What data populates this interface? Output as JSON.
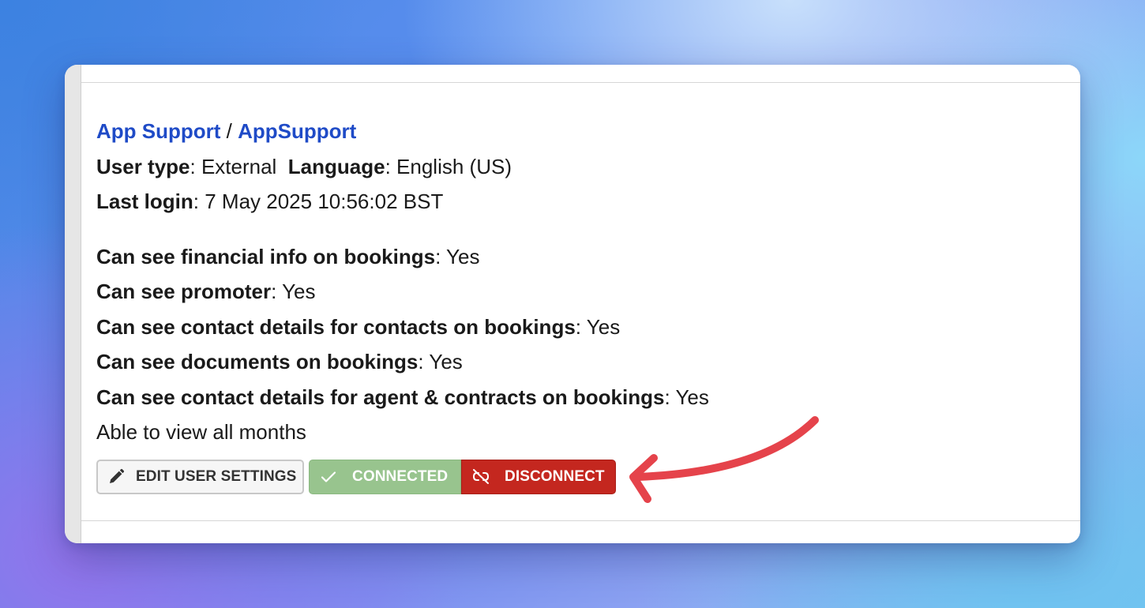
{
  "user": {
    "group_link": "App Support",
    "separator": "/",
    "name_link": "AppSupport",
    "user_type_label": "User type",
    "user_type_value": "External",
    "language_label": "Language",
    "language_value": "English (US)",
    "last_login_label": "Last login",
    "last_login_value": "7 May 2025 10:56:02 BST"
  },
  "permissions": [
    {
      "label": "Can see financial info on bookings",
      "value": "Yes"
    },
    {
      "label": "Can see promoter",
      "value": "Yes"
    },
    {
      "label": "Can see contact details for contacts on bookings",
      "value": "Yes"
    },
    {
      "label": "Can see documents on bookings",
      "value": "Yes"
    },
    {
      "label": "Can see contact details for agent & contracts on bookings",
      "value": "Yes"
    }
  ],
  "months_note": "Able to view all months",
  "actions": {
    "edit_label": "EDIT USER SETTINGS",
    "connected_label": "CONNECTED",
    "disconnect_label": "DISCONNECT"
  },
  "icons": {
    "edit": "pencil-icon",
    "connected": "check-icon",
    "disconnect": "unlink-icon",
    "annotation": "curved-arrow-icon"
  },
  "colors": {
    "link": "#1f4bc7",
    "connected_bg": "#98c48e",
    "disconnect_bg": "#c4271f",
    "annotation_arrow": "#e5434b"
  }
}
